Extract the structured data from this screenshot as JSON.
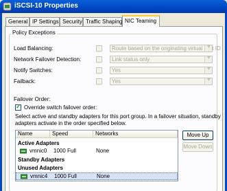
{
  "window": {
    "title": "iSCSI-10 Properties"
  },
  "tabs": [
    {
      "label": "General"
    },
    {
      "label": "IP Settings"
    },
    {
      "label": "Security"
    },
    {
      "label": "Traffic Shaping"
    },
    {
      "label": "NIC Teaming"
    }
  ],
  "policy": {
    "group_label": "Policy Exceptions",
    "rows": [
      {
        "label": "Load Balancing:",
        "value": "Route based on the originating virtual port ID"
      },
      {
        "label": "Network Failover Detection:",
        "value": "Link status only"
      },
      {
        "label": "Notify Switches:",
        "value": "Yes"
      },
      {
        "label": "Failback:",
        "value": "Yes"
      }
    ]
  },
  "failover": {
    "title": "Failover Order:",
    "override_label": "Override switch failover order:",
    "description_line1": "Select active and standby adapters for this port group.  In a failover situation, standby",
    "description_line2": "adapters activate  in the order specified below."
  },
  "adapters": {
    "columns": [
      "Name",
      "Speed",
      "Networks"
    ],
    "groups": {
      "active": "Active Adapters",
      "standby": "Standby Adapters",
      "unused": "Unused Adapters"
    },
    "rows": [
      {
        "name": "vmnic0",
        "speed": "1000 Full",
        "networks": "None"
      },
      {
        "name": "vmnic4",
        "speed": "1000 Full",
        "networks": "None"
      }
    ]
  },
  "buttons": {
    "move_up": "Move Up",
    "move_down": "Move Down"
  },
  "colors": {
    "titlebar": "#0049c6",
    "tab_highlight": "#ffc83c",
    "nic_icon": "#2f8a2f"
  }
}
